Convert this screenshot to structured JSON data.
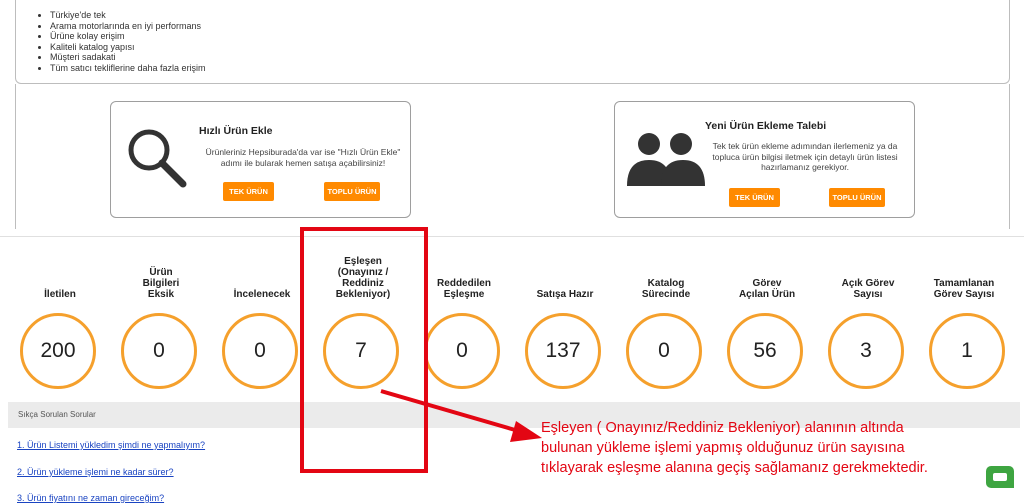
{
  "benefits": [
    "Türkiye'de tek",
    "Arama motorlarında en iyi performans",
    "Ürüne kolay erişim",
    "Kaliteli katalog yapısı",
    "Müşteri sadakati",
    "Tüm satıcı tekliflerine daha fazla erişim"
  ],
  "quick_add": {
    "icon": "magnifier-icon",
    "title": "Hızlı Ürün Ekle",
    "desc_line1": "Ürünleriniz Hepsiburada'da var ise \"Hızlı Ürün Ekle\"",
    "desc_line2": "adımı ile bularak hemen satışa açabilirsiniz!",
    "single_btn": "TEK ÜRÜN",
    "bulk_btn": "TOPLU ÜRÜN"
  },
  "new_request": {
    "icon": "users-icon",
    "title": "Yeni Ürün Ekleme Talebi",
    "desc_line1": "Tek tek ürün ekleme adımından ilerlemeniz ya da",
    "desc_line2": "topluca ürün bilgisi iletmek için detaylı ürün listesi",
    "desc_line3": "hazırlamanız gerekiyor.",
    "single_btn": "TEK ÜRÜN",
    "bulk_btn": "TOPLU ÜRÜN"
  },
  "stats": [
    {
      "l1": "İletilen",
      "l2": "",
      "l3": "",
      "l4": "",
      "value": "200"
    },
    {
      "l1": "Ürün",
      "l2": "Bilgileri",
      "l3": "Eksik",
      "l4": "",
      "value": "0"
    },
    {
      "l1": "İncelenecek",
      "l2": "",
      "l3": "",
      "l4": "",
      "value": "0"
    },
    {
      "l1": "Eşleşen",
      "l2": "(Onayınız /",
      "l3": "Reddiniz",
      "l4": "Bekleniyor)",
      "value": "7"
    },
    {
      "l1": "Reddedilen",
      "l2": "Eşleşme",
      "l3": "",
      "l4": "",
      "value": "0"
    },
    {
      "l1": "Satışa Hazır",
      "l2": "",
      "l3": "",
      "l4": "",
      "value": "137"
    },
    {
      "l1": "Katalog",
      "l2": "Sürecinde",
      "l3": "",
      "l4": "",
      "value": "0"
    },
    {
      "l1": "Görev",
      "l2": "Açılan Ürün",
      "l3": "",
      "l4": "",
      "value": "56"
    },
    {
      "l1": "Açık Görev",
      "l2": "Sayısı",
      "l3": "",
      "l4": "",
      "value": "3"
    },
    {
      "l1": "Tamamlanan",
      "l2": "Görev Sayısı",
      "l3": "",
      "l4": "",
      "value": "1"
    }
  ],
  "faq": {
    "title": "Sıkça Sorulan Sorular",
    "items": [
      "1. Ürün Listemi yükledim şimdi ne yapmalıyım?",
      "2. Ürün yükleme işlemi ne kadar sürer?",
      "3. Ürün fiyatını ne zaman gireceğim?"
    ]
  },
  "annotation": {
    "line1": "Eşleyen ( Onayınız/Reddiniz Bekleniyor) alanının altında",
    "line2": "bulunan yükleme işlemi yapmış olduğunuz ürün sayısına",
    "line3": "tıklayarak eşleşme alanına geçiş sağlamanız gerekmektedir.",
    "color": "#e30613"
  },
  "accent_color": "#ff8a00"
}
